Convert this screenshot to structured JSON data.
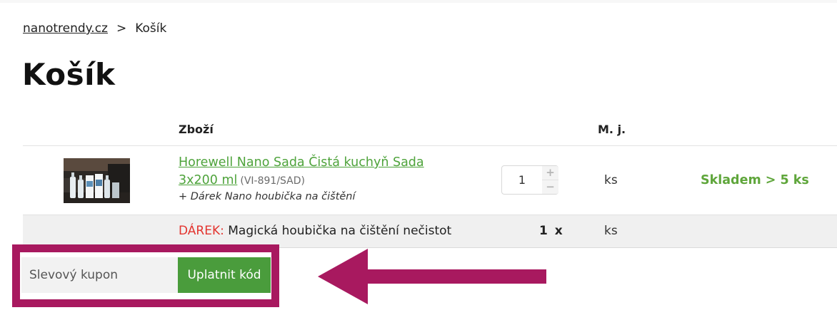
{
  "breadcrumb": {
    "home": "nanotrendy.cz",
    "separator": ">",
    "current": "Košík"
  },
  "page_title": "Košík",
  "table_headers": {
    "product": "Zboží",
    "unit": "M. j."
  },
  "cart_item": {
    "name": "Horewell Nano Sada Čistá kuchyň Sada 3x200 ml",
    "code": "(VI-891/SAD)",
    "gift_note": "+ Dárek Nano houbička na čištění",
    "quantity": "1",
    "unit": "ks",
    "stock": "Skladem > 5 ks",
    "stock_color": "#5fa63b"
  },
  "gift_row": {
    "tag": "DÁREK:",
    "tag_color": "#e3342f",
    "label": " Magická houbička na čištění nečistot",
    "quantity": "1 x",
    "unit": "ks"
  },
  "coupon": {
    "placeholder": "Slevový kupon",
    "value": "",
    "apply_label": "Uplatnit kód"
  },
  "annotation": {
    "highlight_color": "#a8195f"
  },
  "icons": {
    "increase": "plus-icon",
    "decrease": "minus-icon",
    "annotation": "arrow-left-icon"
  }
}
